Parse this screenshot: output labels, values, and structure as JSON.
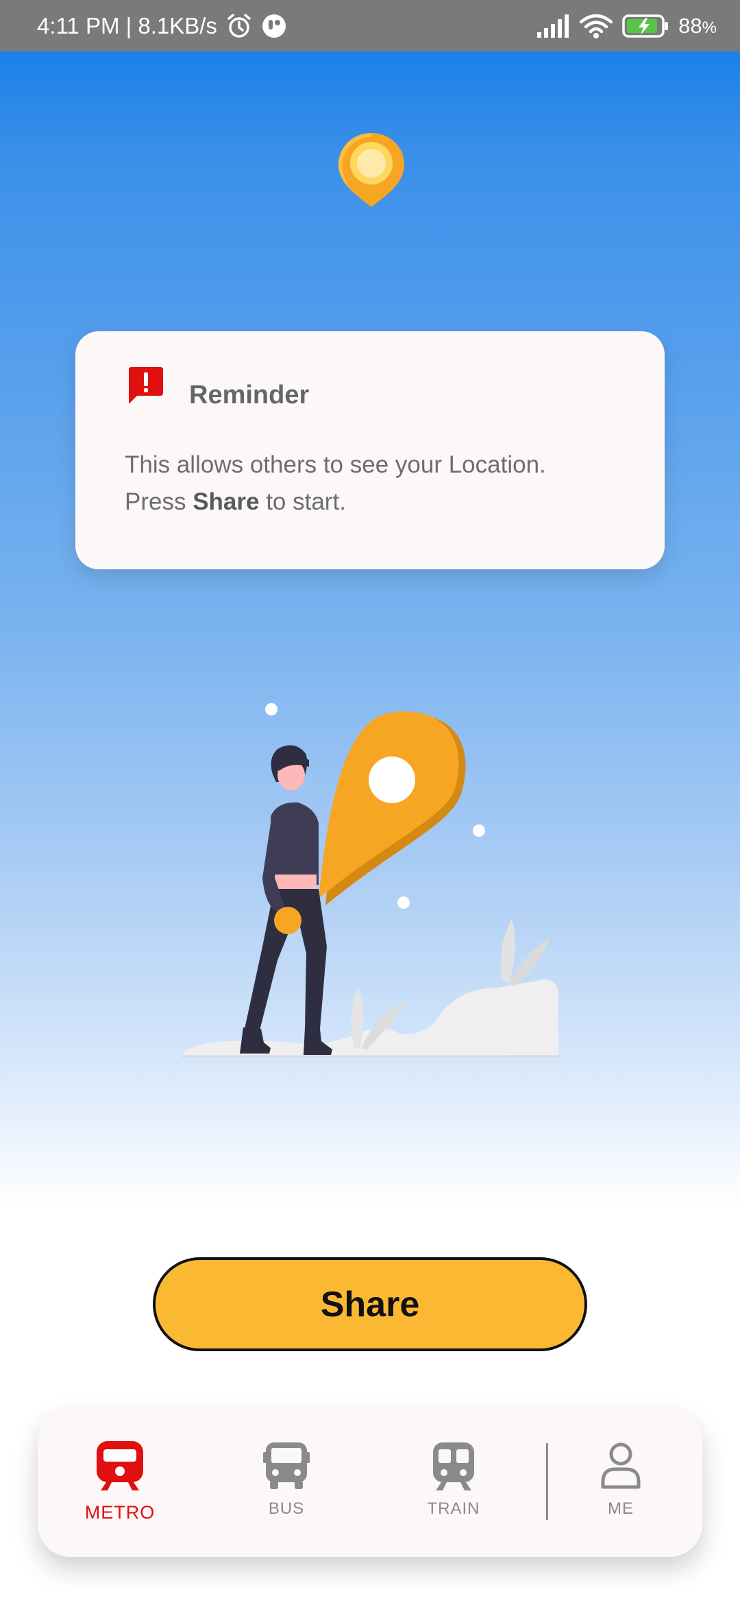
{
  "status_bar": {
    "time_speed": "4:11 PM | 8.1KB/s",
    "battery": "88",
    "battery_unit": "%",
    "icons": [
      "alarm-icon",
      "app-notification-icon",
      "signal-icon",
      "wifi-icon",
      "battery-charging-icon"
    ]
  },
  "reminder": {
    "title": "Reminder",
    "line1": "This allows others to see your Location.",
    "line2_prefix": "Press ",
    "line2_bold": "Share",
    "line2_suffix": " to start.",
    "icon": "alert-message-icon",
    "icon_color": "#e01010"
  },
  "share_button": {
    "label": "Share",
    "color": "#fbb933"
  },
  "bottom_nav": {
    "active_color": "#e01010",
    "inactive_color": "#8a8a8a",
    "items": [
      {
        "label": "METRO",
        "icon": "metro-icon",
        "active": true
      },
      {
        "label": "BUS",
        "icon": "bus-icon",
        "active": false
      },
      {
        "label": "TRAIN",
        "icon": "train-icon",
        "active": false
      },
      {
        "label": "ME",
        "icon": "person-icon",
        "active": false
      }
    ]
  }
}
